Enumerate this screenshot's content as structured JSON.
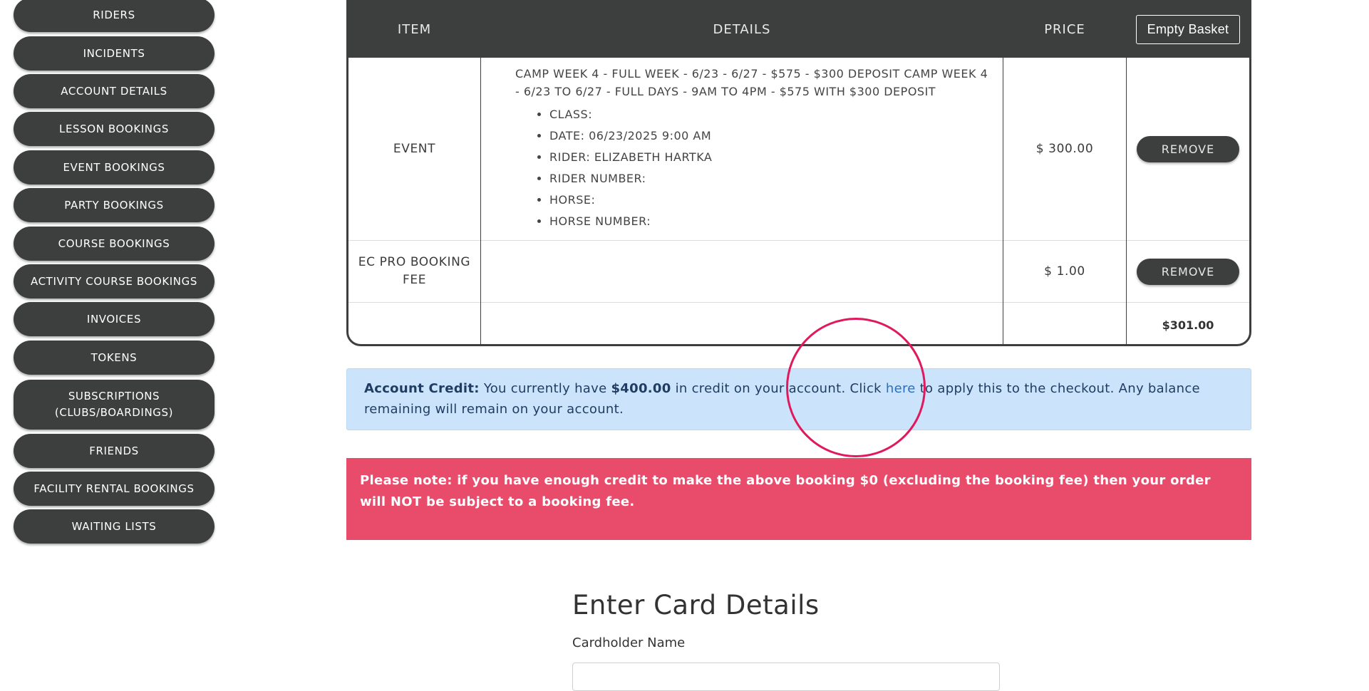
{
  "sidebar": {
    "items": [
      {
        "label": "RIDERS"
      },
      {
        "label": "INCIDENTS"
      },
      {
        "label": "ACCOUNT DETAILS"
      },
      {
        "label": "LESSON BOOKINGS"
      },
      {
        "label": "EVENT BOOKINGS"
      },
      {
        "label": "PARTY BOOKINGS"
      },
      {
        "label": "COURSE BOOKINGS"
      },
      {
        "label": "ACTIVITY COURSE BOOKINGS"
      },
      {
        "label": "INVOICES"
      },
      {
        "label": "TOKENS"
      },
      {
        "label": "SUBSCRIPTIONS (CLUBS/BOARDINGS)"
      },
      {
        "label": "FRIENDS"
      },
      {
        "label": "FACILITY RENTAL BOOKINGS"
      },
      {
        "label": "WAITING LISTS"
      }
    ]
  },
  "basket": {
    "headers": {
      "item": "ITEM",
      "details": "DETAILS",
      "price": "PRICE"
    },
    "empty_button": "Empty Basket",
    "rows": [
      {
        "item": "EVENT",
        "title": "CAMP WEEK 4 - FULL WEEK - 6/23 - 6/27 - $575 - $300 DEPOSIT CAMP WEEK 4 - 6/23 TO 6/27 - FULL DAYS - 9AM TO 4PM - $575 WITH $300 DEPOSIT",
        "details": [
          "CLASS:",
          "DATE: 06/23/2025 9:00 AM",
          "RIDER: ELIZABETH HARTKA",
          "RIDER NUMBER:",
          "HORSE:",
          "HORSE NUMBER:"
        ],
        "price": "$ 300.00",
        "action": "REMOVE"
      },
      {
        "item": "EC PRO BOOKING FEE",
        "price": "$ 1.00",
        "action": "REMOVE"
      }
    ],
    "total": "$301.00"
  },
  "credit": {
    "label": "Account Credit:",
    "text1": " You currently have ",
    "amount": "$400.00",
    "text2": " in credit on your account. Click ",
    "link": "here",
    "text3": " to apply this to the checkout. Any balance remaining will remain on your account."
  },
  "note": {
    "text": "Please note: if you have enough credit to make the above booking $0 (excluding the booking fee) then your order will NOT be subject to a booking fee."
  },
  "card": {
    "title": "Enter Card Details",
    "cardholder_label": "Cardholder Name"
  },
  "colors": {
    "button_dark": "#3c3f3e",
    "credit_bg": "#cce4fb",
    "note_bg": "#e94c6b",
    "highlight": "#e0195c"
  }
}
